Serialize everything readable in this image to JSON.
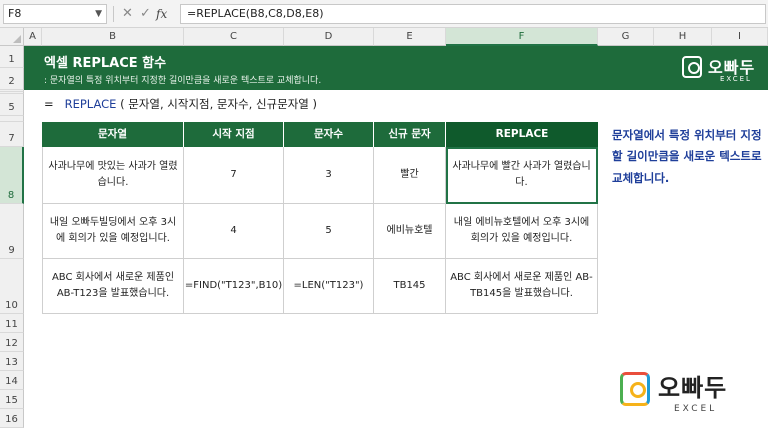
{
  "formula_bar": {
    "name_box": "F8",
    "cancel_icon": "✕",
    "enter_icon": "✓",
    "fx_label": "fx",
    "formula": "=REPLACE(B8,C8,D8,E8)"
  },
  "columns": [
    "A",
    "B",
    "C",
    "D",
    "E",
    "F",
    "G",
    "H",
    "I"
  ],
  "selected_column": "F",
  "rows": [
    "1",
    "2",
    "3",
    "4",
    "5",
    "6",
    "7",
    "8",
    "9",
    "10",
    "11",
    "12",
    "13",
    "14",
    "15",
    "16"
  ],
  "selected_row": "8",
  "banner": {
    "title": "엑셀 REPLACE 함수",
    "subtitle": ": 문자열의 특정 위치부터 지정한 길이만큼을 새로운 텍스트로 교체합니다.",
    "logo_text": "오빠두",
    "logo_sub": "EXCEL"
  },
  "syntax": {
    "eq": "=",
    "fn": "REPLACE",
    "args": "( 문자열, 시작지점, 문자수, 신규문자열 )"
  },
  "table": {
    "headers": [
      "문자열",
      "시작 지점",
      "문자수",
      "신규 문자",
      "REPLACE"
    ],
    "rows": [
      [
        "사과나무에 맛있는 사과가 열렸습니다.",
        "7",
        "3",
        "빨간",
        "사과나무에 빨간 사과가 열렸습니다."
      ],
      [
        "내일 오빠두빌딩에서 오후 3시에 회의가 있을 예정입니다.",
        "4",
        "5",
        "에비뉴호텔",
        "내일 에비뉴호텔에서 오후 3시에 회의가 있을 예정입니다."
      ],
      [
        "ABC 회사에서 새로운 제품인 AB-T123을 발표했습니다.",
        "=FIND(\"T123\",B10)",
        "=LEN(\"T123\")",
        "TB145",
        "ABC 회사에서 새로운 제품인 AB-TB145을 발표했습니다."
      ]
    ]
  },
  "note": "문자열에서 특정 위치부터 지정할 길이만큼을 새로운 텍스트로 교체합니다.",
  "logo": {
    "text": "오빠두",
    "sub": "EXCEL"
  },
  "colors": {
    "accent_green": "#1e6b3b",
    "note_blue": "#1f3f9a"
  }
}
